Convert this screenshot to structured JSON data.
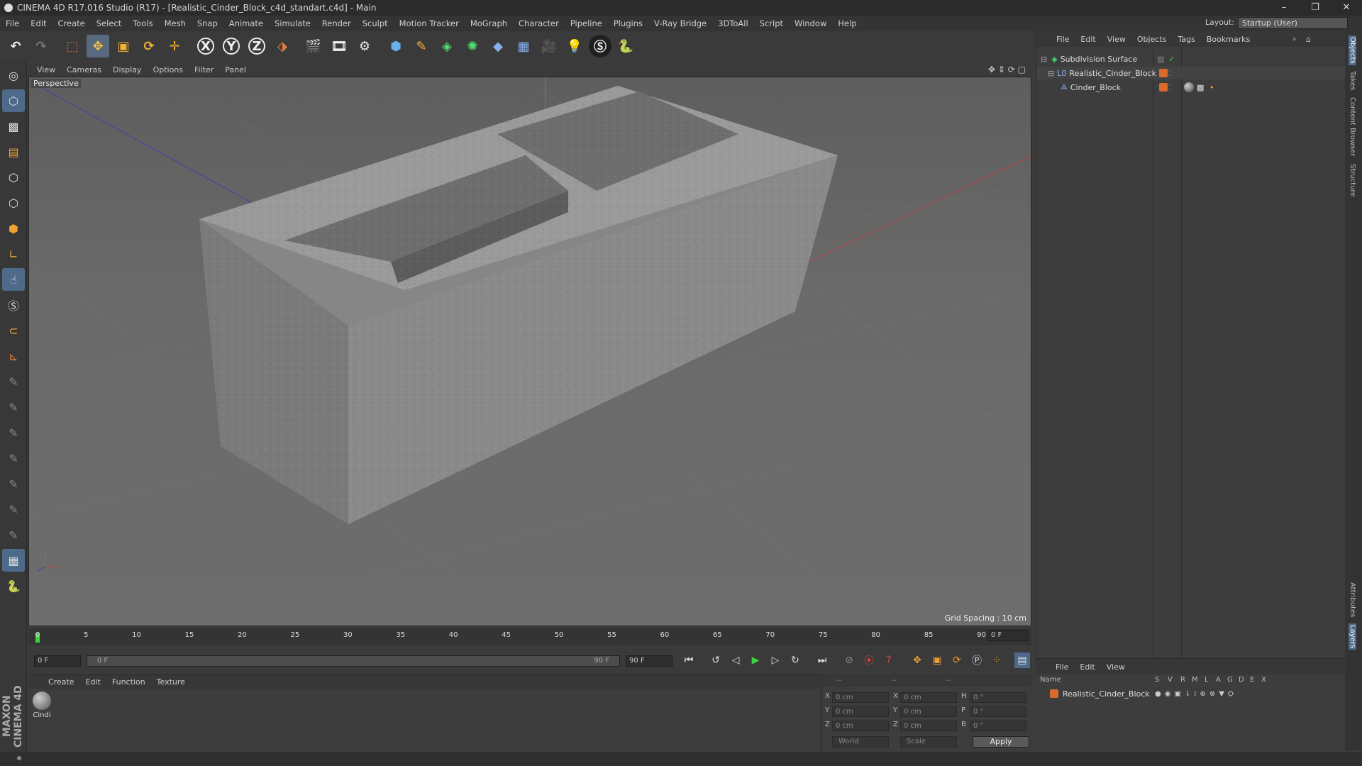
{
  "window": {
    "title": "CINEMA 4D R17.016 Studio (R17) - [Realistic_Cinder_Block_c4d_standart.c4d] - Main",
    "controls": [
      "–",
      "❐",
      "✕"
    ]
  },
  "menubar": {
    "items": [
      "File",
      "Edit",
      "Create",
      "Select",
      "Tools",
      "Mesh",
      "Snap",
      "Animate",
      "Simulate",
      "Render",
      "Sculpt",
      "Motion Tracker",
      "MoGraph",
      "Character",
      "Pipeline",
      "Plugins",
      "V-Ray Bridge",
      "3DToAll",
      "Script",
      "Window",
      "Help"
    ],
    "layout_label": "Layout:",
    "layout_value": "Startup (User)"
  },
  "toolbar": {
    "x": "X",
    "y": "Y",
    "z": "Z"
  },
  "viewport": {
    "menu": [
      "View",
      "Cameras",
      "Display",
      "Options",
      "Filter",
      "Panel"
    ],
    "camera_label": "Perspective",
    "grid_spacing": "Grid Spacing : 10 cm"
  },
  "timeline": {
    "ticks": [
      "0",
      "5",
      "10",
      "15",
      "20",
      "25",
      "30",
      "35",
      "40",
      "45",
      "50",
      "55",
      "60",
      "65",
      "70",
      "75",
      "80",
      "85",
      "90"
    ],
    "current_frame": "0 F",
    "start_field": "0 F",
    "range_start": "0 F",
    "range_end": "90 F",
    "end_field": "90 F"
  },
  "material_manager": {
    "menu": [
      "Create",
      "Edit",
      "Function",
      "Texture"
    ],
    "material_name": "Cindi"
  },
  "coordinates": {
    "header": [
      "--",
      "--",
      "--"
    ],
    "rows": [
      {
        "axis": "X",
        "pos": "0 cm",
        "axis2": "X",
        "size": "0 cm",
        "axis3": "H",
        "rot": "0 °"
      },
      {
        "axis": "Y",
        "pos": "0 cm",
        "axis2": "Y",
        "size": "0 cm",
        "axis3": "P",
        "rot": "0 °"
      },
      {
        "axis": "Z",
        "pos": "0 cm",
        "axis2": "Z",
        "size": "0 cm",
        "axis3": "B",
        "rot": "0 °"
      }
    ],
    "space": "World",
    "mode": "Scale",
    "apply": "Apply"
  },
  "object_manager": {
    "menu": [
      "File",
      "Edit",
      "View",
      "Objects",
      "Tags",
      "Bookmarks"
    ],
    "objects": [
      {
        "name": "Subdivision Surface"
      },
      {
        "name": "Realistic_Cinder_Block"
      },
      {
        "name": "Cinder_Block"
      }
    ]
  },
  "attribute_manager": {
    "menu": [
      "File",
      "Edit",
      "View"
    ],
    "columns": [
      "Name",
      "S",
      "V",
      "R",
      "M",
      "L",
      "A",
      "G",
      "D",
      "E",
      "X"
    ],
    "layer_name": "Realistic_Cinder_Block"
  },
  "right_tabs": [
    "Objects",
    "Takes",
    "Content Browser",
    "Structure",
    "Attributes",
    "Layers"
  ],
  "brand": "MAXON CINEMA 4D",
  "colors": {
    "accent": "#596a80",
    "layer_orange": "#d86a2c",
    "x_axis": "#c04040",
    "y_axis": "#3fa03f",
    "z_axis": "#4040b0"
  }
}
